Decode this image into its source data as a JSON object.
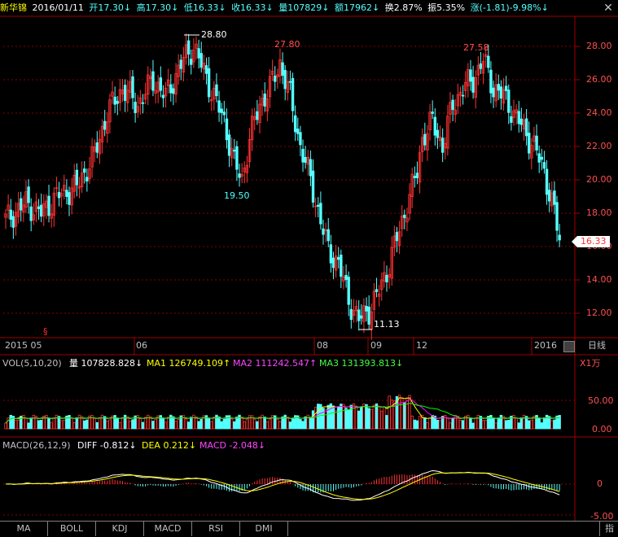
{
  "header": {
    "stock_name": "新华锦",
    "date": "2016/01/11",
    "open": "开17.30↓",
    "high": "高17.30↓",
    "low": "低16.33↓",
    "close": "收16.33↓",
    "volume": "量107829↓",
    "amount": "额17962↓",
    "turnover": "换2.87%",
    "amplitude": "振5.35%",
    "change": "涨(-1.81)-9.98%↓",
    "close_icon": "close-x-icon"
  },
  "price_axis": {
    "labels": [
      "28.00",
      "26.00",
      "24.00",
      "22.00",
      "20.00",
      "18.00",
      "16.00",
      "14.00",
      "12.00"
    ],
    "current_price": "16.33"
  },
  "annotations": {
    "high1": "28.80",
    "high2": "27.80",
    "high3": "27.58",
    "low1": "19.50",
    "low2": "11.13"
  },
  "time_axis": {
    "labels": [
      "2015 05",
      "06",
      "08",
      "09",
      "12",
      "2016"
    ],
    "period_label": "日线",
    "marker": "§"
  },
  "volume_panel": {
    "title": "VOL(5,10,20)",
    "vol": "量 107828.828↓",
    "ma1": "MA1 126749.109↑",
    "ma2": "MA2 111242.547↑",
    "ma3": "MA3 131393.813↓",
    "unit": "X1万",
    "axis": [
      "50.00",
      "0.00"
    ]
  },
  "macd_panel": {
    "title": "MACD(26,12,9)",
    "diff": "DIFF -0.812↓",
    "dea": "DEA 0.212↓",
    "macd": "MACD -2.048↓",
    "axis": [
      "0",
      "-5.00"
    ]
  },
  "tabs": [
    "MA",
    "BOLL",
    "KDJ",
    "MACD",
    "RSI",
    "DMI"
  ],
  "tab_right": "指",
  "colors": {
    "up": "#ff3232",
    "down": "#54ffff",
    "grid": "#8b0000",
    "ma1": "#ffff00",
    "ma2": "#ff00ff",
    "ma3": "#00ff00",
    "text_yellow": "#ffff00",
    "text_white": "#ffffff"
  }
}
